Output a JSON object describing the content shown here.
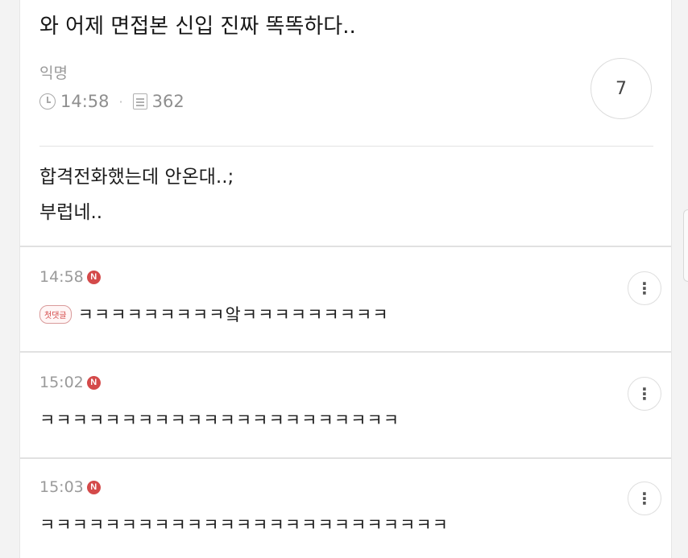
{
  "post": {
    "title": "와 어제 면접본 신입 진짜 똑똑하다..",
    "author": "익명",
    "time": "14:58",
    "views": "362",
    "comment_count": "7",
    "body_line1": "합격전화했는데 안온대..;",
    "body_line2": "부럽네.."
  },
  "comments": [
    {
      "time": "14:58",
      "badge": "N",
      "tag": "첫댓글",
      "text": "ㅋㅋㅋㅋㅋㅋㅋㅋㅋ앜ㅋㅋㅋㅋㅋㅋㅋㅋㅋ"
    },
    {
      "time": "15:02",
      "badge": "N",
      "text": "ㅋㅋㅋㅋㅋㅋㅋㅋㅋㅋㅋㅋㅋㅋㅋㅋㅋㅋㅋㅋㅋㅋ"
    },
    {
      "time": "15:03",
      "badge": "N",
      "text": "ㅋㅋㅋㅋㅋㅋㅋㅋㅋㅋㅋㅋㅋㅋㅋㅋㅋㅋㅋㅋㅋㅋㅋㅋㅋ"
    }
  ],
  "more_glyph": "⋮",
  "colors": {
    "new_badge": "#d44a4a",
    "text": "#1d1d1d",
    "muted": "#9a9a9a"
  }
}
